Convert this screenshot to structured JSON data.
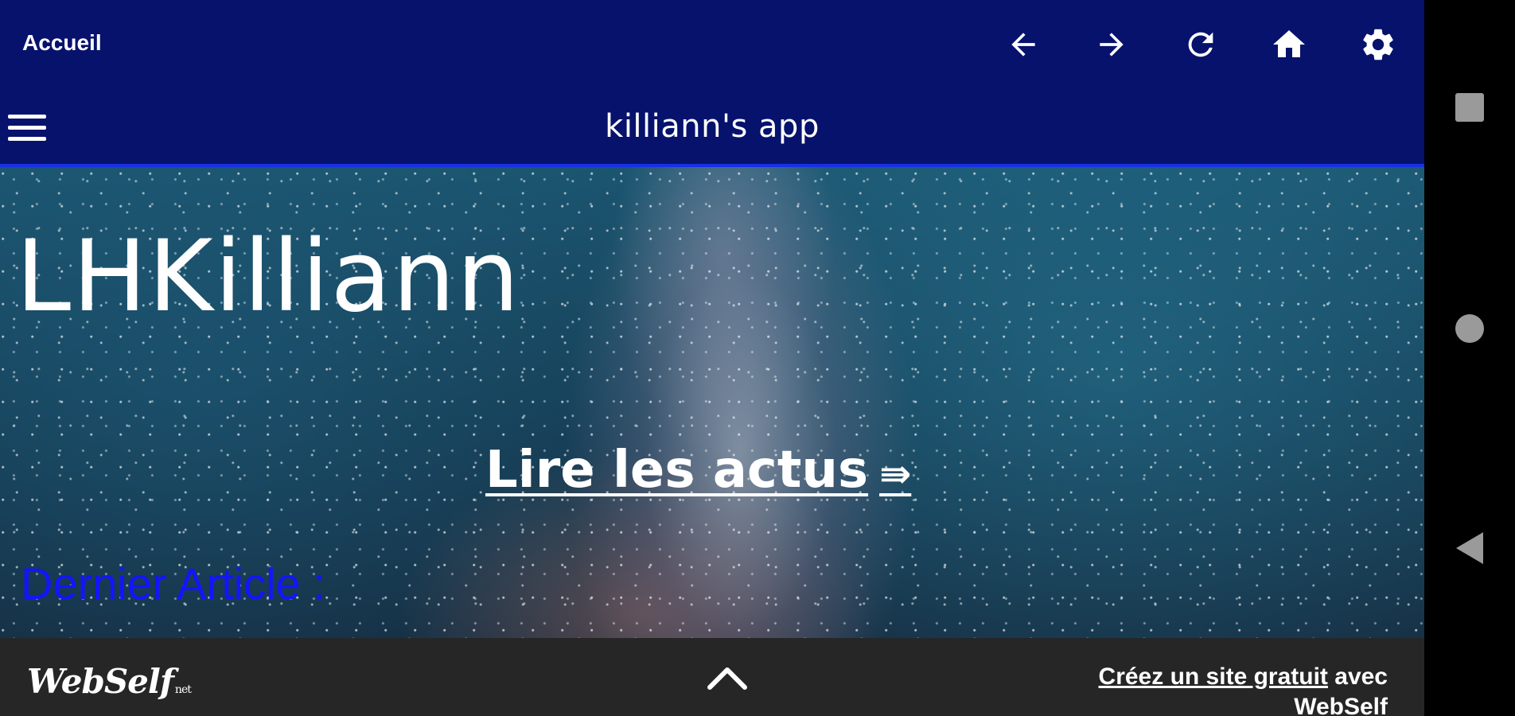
{
  "toolbar": {
    "title": "Accueil",
    "icons": [
      "arrow-left-icon",
      "arrow-right-icon",
      "refresh-icon",
      "home-icon",
      "gear-icon"
    ]
  },
  "appbar": {
    "menu_icon": "hamburger-menu-icon",
    "title": "killiann's app"
  },
  "hero": {
    "site_title": "LHKilliann",
    "cta_label": "Lire les actus",
    "cta_arrow": "⇛",
    "section_heading": "Dernier Article :"
  },
  "footer": {
    "logo_text": "WebSelf",
    "logo_suffix": "net",
    "up_icon": "chevron-up-icon",
    "promo_link": "Créez un site gratuit",
    "promo_rest": " avec WebSelf"
  },
  "navbar": {
    "icons": [
      "recents-square-icon",
      "home-circle-icon",
      "back-triangle-icon"
    ]
  },
  "colors": {
    "toolbar_bg": "#06126c",
    "appbar_accent": "#1730e6",
    "heading_blue": "#1414ff",
    "footer_bg": "#262626"
  }
}
